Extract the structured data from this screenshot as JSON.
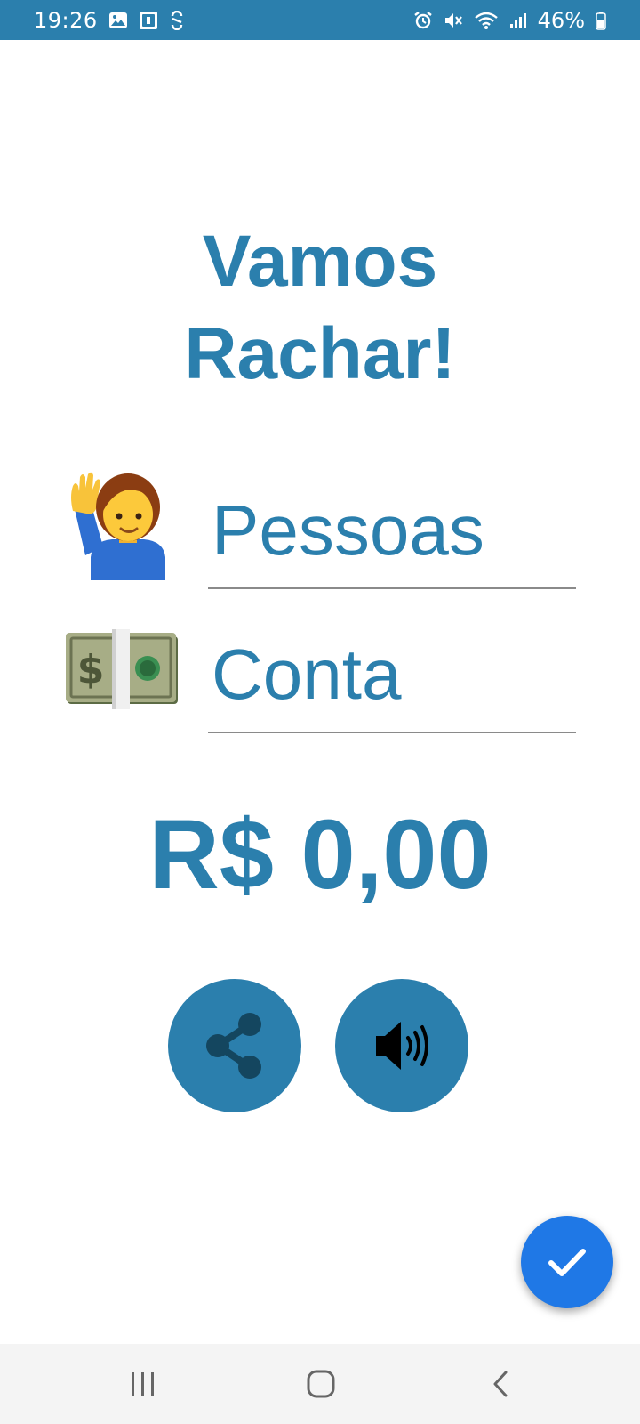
{
  "status_bar": {
    "time": "19:26",
    "battery": "46%",
    "left_icons": [
      "gallery-icon",
      "app-notification-icon",
      "sync-icon"
    ],
    "right_icons": [
      "alarm-icon",
      "mute-icon",
      "wifi-icon",
      "signal-icon",
      "battery-icon"
    ]
  },
  "app": {
    "title_line1": "Vamos",
    "title_line2": "Rachar!",
    "people_field": {
      "emoji": "🙋‍♂️",
      "placeholder": "Pessoas",
      "value": ""
    },
    "bill_field": {
      "emoji": "💵",
      "placeholder": "Conta",
      "value": ""
    },
    "result": "R$ 0,00",
    "share_button": "share-icon",
    "speak_button": "speaker-icon",
    "fab": "check-icon"
  },
  "navigation_bar": {
    "items": [
      "recents-icon",
      "home-icon",
      "back-icon"
    ]
  },
  "colors": {
    "primary": "#2b7fad",
    "fab": "#1f78e6",
    "underline": "#8a8a8a",
    "nav_background": "#f4f4f4"
  }
}
